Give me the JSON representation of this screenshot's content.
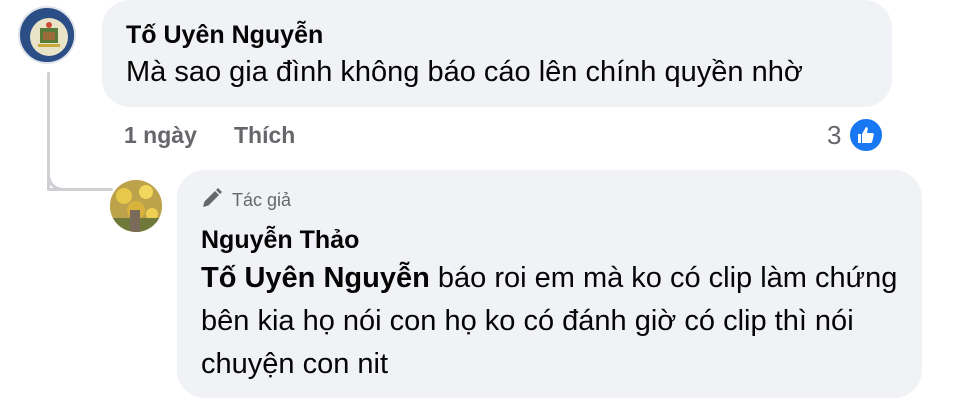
{
  "main_comment": {
    "author": "Tố Uyên Nguyễn",
    "text": "Mà sao gia đình không báo cáo lên chính quyền nhờ",
    "time": "1 ngày",
    "like_label": "Thích",
    "reaction_count": "3"
  },
  "reply": {
    "badge_label": "Tác giả",
    "author": "Nguyễn Thảo",
    "mention": "Tố Uyên Nguyễn",
    "text_lines": [
      "báo roi em mà ko có clip làm",
      "chứng bên kia họ nói con họ ko có đánh giờ có",
      "clip thì nói chuyện con nit"
    ]
  },
  "icons": {
    "like_reaction": "thumbs-up-icon",
    "author_badge": "pen-icon"
  },
  "colors": {
    "bubble": "#f0f2f5",
    "like_blue": "#1877f2",
    "meta_gray": "#65676b"
  }
}
